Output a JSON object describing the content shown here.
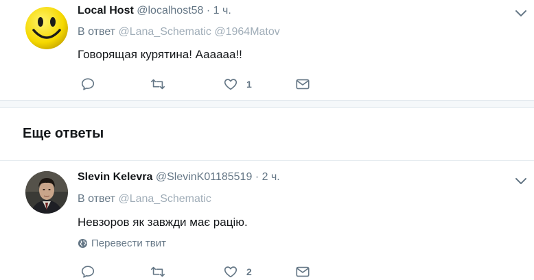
{
  "tweets": [
    {
      "fullname": "Local Host",
      "username": "@localhost58",
      "dot": "·",
      "time": "1 ч.",
      "reply_prefix": "В ответ",
      "reply_mentions": [
        "@Lana_Schematic",
        "@1964Matov"
      ],
      "text": "Говорящая курятина! Аааааа!!",
      "retweet_count": "",
      "like_count": "1",
      "avatar": "smiley-face"
    },
    {
      "fullname": "Slevin Kelevra",
      "username": "@SlevinK01185519",
      "dot": "·",
      "time": "2 ч.",
      "reply_prefix": "В ответ",
      "reply_mentions": [
        "@Lana_Schematic"
      ],
      "text": "Невзоров як завжди має рацію.",
      "translate_label": "Перевести твит",
      "like_count": "2",
      "avatar": "person-photo"
    }
  ],
  "more_replies_title": "Еще ответы",
  "colors": {
    "text_primary": "#14171a",
    "text_secondary": "#657786",
    "mention": "#a0adb8",
    "separator": "#e6ecf0",
    "icon": "#657786"
  }
}
